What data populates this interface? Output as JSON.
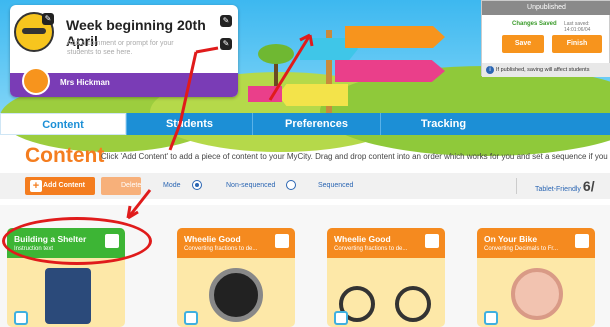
{
  "header": {
    "week_title": "Week beginning 20th April",
    "prompt_placeholder": "Add a comment or prompt for your students to see here.",
    "teacher_name": "Mrs Hickman"
  },
  "status": {
    "publish_state": "Unpublished",
    "changes_saved": "Changes Saved",
    "last_saved": "Last saved: 14:01:06/04",
    "save_label": "Save",
    "finish_label": "Finish",
    "warning": "If published, saving will affect students"
  },
  "tabs": [
    {
      "label": "Content",
      "active": true
    },
    {
      "label": "Students",
      "active": false
    },
    {
      "label": "Preferences",
      "active": false
    },
    {
      "label": "Tracking",
      "active": false
    }
  ],
  "content": {
    "heading": "Content",
    "description": "Click 'Add Content' to add a piece of content to your MyCity. Drag and drop content into an order which works for you and set a sequence if you wish"
  },
  "toolbar": {
    "add_label": "Add Content",
    "delete_label": "Delete",
    "mode_label": "Mode",
    "non_sequenced_label": "Non-sequenced",
    "sequenced_label": "Sequenced",
    "mode_selected": "Non-sequenced",
    "tablet_label": "Tablet-Friendly",
    "tablet_count": "6/"
  },
  "cards": [
    {
      "title": "Building a Shelter",
      "subtitle": "Instruction text",
      "color": "#3db535"
    },
    {
      "title": "Wheelie Good",
      "subtitle": "Converting fractions to de...",
      "color": "#f58a1f"
    },
    {
      "title": "Wheelie Good",
      "subtitle": "Converting fractions to de...",
      "color": "#f58a1f"
    },
    {
      "title": "On Your Bike",
      "subtitle": "Converting Decimals to Fr...",
      "color": "#f58a1f"
    }
  ],
  "colors": {
    "accent_blue": "#1c8fd6",
    "accent_orange": "#f47d1f",
    "annotation_red": "#e01b1b",
    "header_purple": "#7a3cb6"
  }
}
